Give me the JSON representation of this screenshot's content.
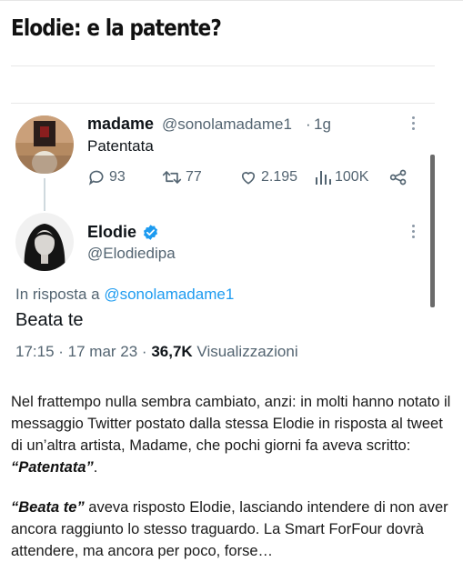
{
  "headline": "Elodie: e la patente?",
  "tweet_madame": {
    "name": "madame",
    "handle": "@sonolamadame1",
    "separator": "·",
    "time": "1g",
    "text": "Patentata",
    "replies": "93",
    "retweets": "77",
    "likes": "2.195",
    "views": "100K"
  },
  "tweet_elodie": {
    "name": "Elodie",
    "handle": "@Elodiedipa",
    "reply_prefix": "In risposta a",
    "reply_to": "@sonolamadame1",
    "text": "Beata te",
    "timestamp": "17:15 · 17 mar 23 ·",
    "views_count": "36,7K",
    "views_label": "Visualizzazioni",
    "verified_color": "#1d9bf0"
  },
  "article": {
    "p1_text": "Nel frattempo nulla sembra cambiato, anzi: in molti hanno notato il messaggio Twitter postato dalla stessa Elodie in risposta al tweet di un’altra artista, Madame, che pochi giorni fa aveva scritto: ",
    "p1_quote": "“Patentata”",
    "p1_end": ".",
    "p2_quote": "“Beata te”",
    "p2_text": " aveva risposto Elodie, lasciando intendere di non aver ancora raggiunto lo stesso traguardo. La Smart ForFour dovrà attendere, ma ancora per poco, forse…"
  },
  "icons": {
    "reply": "reply-icon",
    "retweet": "retweet-icon",
    "like": "heart-icon",
    "views": "views-chart-icon",
    "share": "share-icon",
    "more": "more-dots-icon",
    "verified": "verified-badge-icon"
  }
}
